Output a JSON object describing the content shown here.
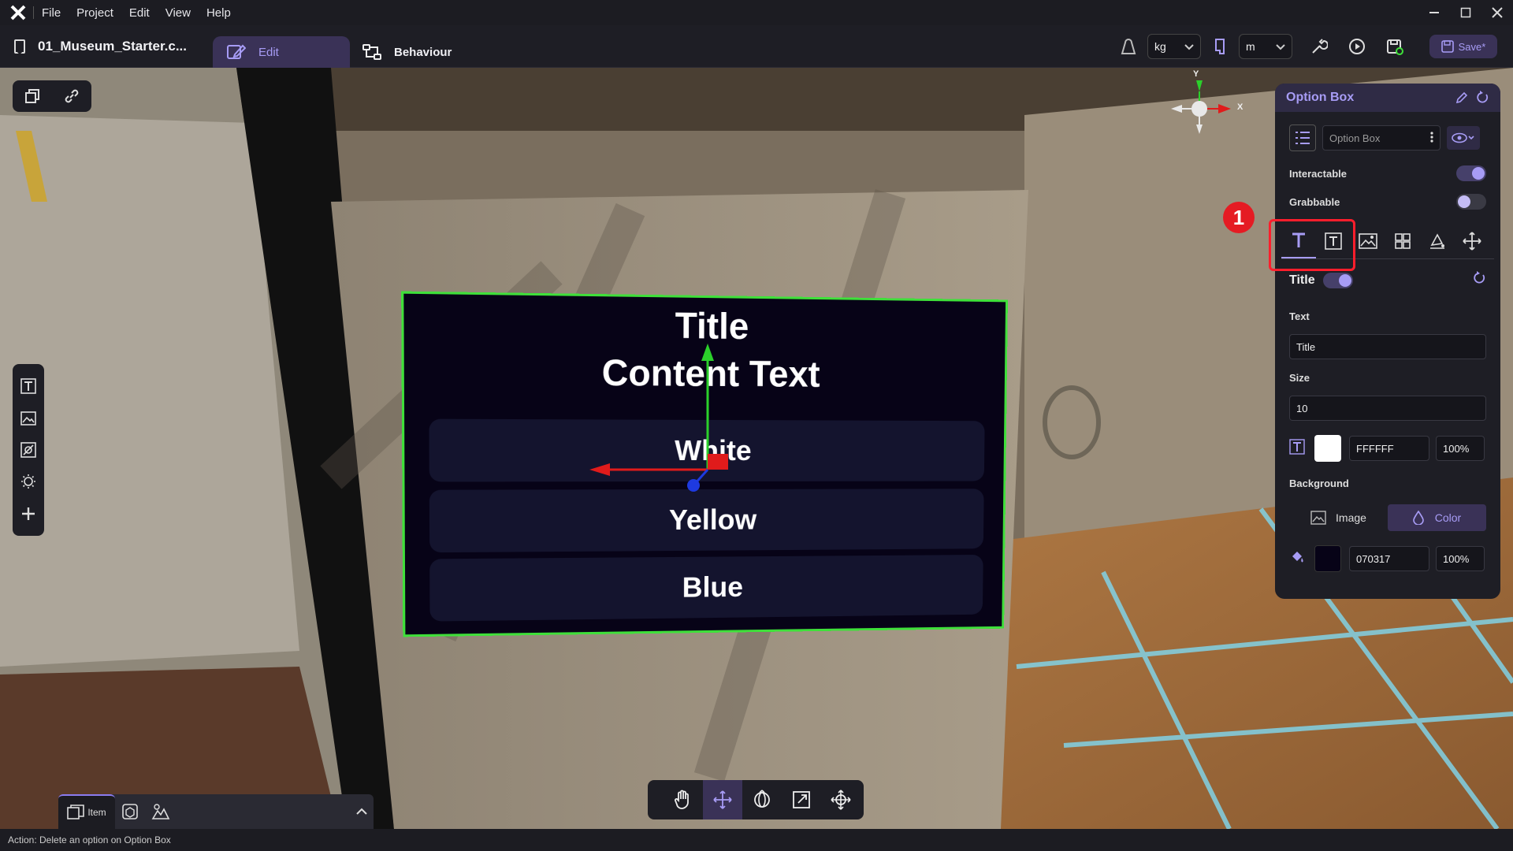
{
  "menubar": {
    "items": [
      "File",
      "Project",
      "Edit",
      "View",
      "Help"
    ]
  },
  "toolbar": {
    "project_name": "01_Museum_Starter.c...",
    "tab_edit": "Edit",
    "tab_behaviour": "Behaviour",
    "mass_unit": "kg",
    "length_unit": "m",
    "save_label": "Save*"
  },
  "option_box": {
    "title": "Title",
    "content": "Content Text",
    "options": [
      "White",
      "Yellow",
      "Blue"
    ]
  },
  "gizmo": {
    "y_label": "Y",
    "x_label": "X"
  },
  "dock": {
    "item_label": "Item"
  },
  "panel": {
    "header": "Option Box",
    "object_name": "Option Box",
    "interactable_label": "Interactable",
    "grabbable_label": "Grabbable",
    "title_label": "Title",
    "text_label": "Text",
    "text_value": "Title",
    "size_label": "Size",
    "size_value": "10",
    "text_color_hex": "FFFFFF",
    "text_color_opacity": "100%",
    "background_label": "Background",
    "bg_image_label": "Image",
    "bg_color_label": "Color",
    "bg_color_hex": "070317",
    "bg_color_opacity": "100%"
  },
  "annotation": {
    "badge": "1"
  },
  "status": {
    "text": "Action: Delete an option on Option Box"
  },
  "colors": {
    "accent": "#a79cf5",
    "selection_outline": "#3fe03a",
    "annotation_red": "#ff1e2c",
    "text_color": "#FFFFFF",
    "bg_color": "#070317"
  }
}
